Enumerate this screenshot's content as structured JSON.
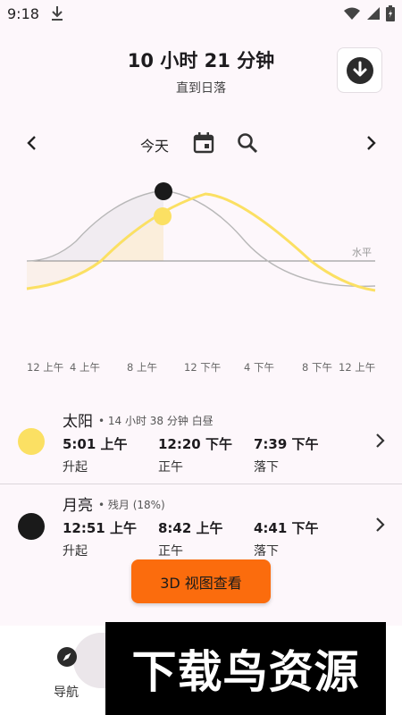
{
  "status_bar": {
    "time": "9:18"
  },
  "header": {
    "title": "10 小时 21 分钟",
    "subtitle": "直到日落"
  },
  "date_nav": {
    "today": "今天"
  },
  "chart": {
    "horizon_label": "水平",
    "tick_labels": [
      "12 上午",
      "4 上午",
      "8 上午",
      "12 下午",
      "4 下午",
      "8 下午",
      "12 上午"
    ],
    "colors": {
      "sun": "#fbe063",
      "moon": "#1a1a1a",
      "moon_curve": "#b8b8b8",
      "horizon": "#888888"
    }
  },
  "sun": {
    "name": "太阳",
    "meta": "• 14 小时 38 分钟 白昼",
    "rise_time": "5:01 上午",
    "rise_label": "升起",
    "noon_time": "12:20 下午",
    "noon_label": "正午",
    "set_time": "7:39 下午",
    "set_label": "落下"
  },
  "moon": {
    "name": "月亮",
    "meta": "• 残月 (18%)",
    "rise_time": "12:51 上午",
    "rise_label": "升起",
    "noon_time": "8:42 上午",
    "noon_label": "正午",
    "set_time": "4:41 下午",
    "set_label": "落下"
  },
  "actions": {
    "view3d": "3D 视图查看"
  },
  "bottom_nav": {
    "navigation_label": "导航"
  },
  "watermark": {
    "text": "下载鸟资源"
  },
  "colors": {
    "accent": "#fb6c0d",
    "background": "#fdf7fb"
  }
}
